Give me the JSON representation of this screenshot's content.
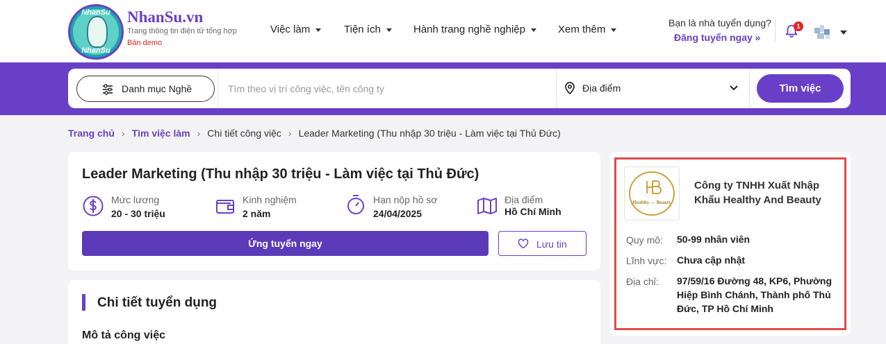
{
  "header": {
    "logo_top": "NhanSu",
    "logo_bottom": "NhanSu",
    "brand_name": "NhanSu.vn",
    "brand_tagline": "Trang thông tin điện tử tổng hợp",
    "brand_demo": "Bản demo",
    "nav": [
      {
        "label": "Việc làm"
      },
      {
        "label": "Tiện ích"
      },
      {
        "label": "Hành trang nghề nghiệp"
      },
      {
        "label": "Xem thêm"
      }
    ],
    "recruiter_question": "Bạn là nhà tuyển dụng?",
    "recruiter_link": "Đăng tuyển ngay »",
    "notification_count": "1"
  },
  "search": {
    "category_label": "Danh mục Nghề",
    "keyword_placeholder": "Tìm theo vị trí công việc, tên công ty",
    "location_label": "Địa điểm",
    "submit_label": "Tìm việc"
  },
  "breadcrumb": [
    {
      "label": "Trang chủ"
    },
    {
      "label": "Tìm việc làm"
    },
    {
      "label": "Chi tiết công việc"
    },
    {
      "label": "Leader Marketing (Thu nhập 30 triệu - Làm việc tại Thủ Đức)"
    }
  ],
  "job": {
    "title": "Leader Marketing (Thu nhập 30 triệu - Làm việc tại Thủ Đức)",
    "info": [
      {
        "label": "Mức lương",
        "value": "20 - 30 triệu"
      },
      {
        "label": "Kinh nghiệm",
        "value": "2 năm"
      },
      {
        "label": "Hạn nộp hồ sơ",
        "value": "24/04/2025"
      },
      {
        "label": "Địa điểm",
        "value": "Hồ Chí Minh"
      }
    ],
    "apply_label": "Ứng tuyển ngay",
    "save_label": "Lưu tin"
  },
  "detail": {
    "section_title": "Chi tiết tuyển dụng",
    "description_title": "Mô tả công việc"
  },
  "company": {
    "logo_text": "Healthy — Beauty",
    "name": "Công ty TNHH Xuất Nhập Khẩu Healthy And Beauty",
    "size_label": "Quy mô:",
    "size_value": "50-99 nhân viên",
    "field_label": "Lĩnh vực:",
    "field_value": "Chưa cập nhật",
    "address_label": "Địa chỉ:",
    "address_value": "97/59/16 Đường 48, KP6, Phường Hiệp Bình Chánh, Thành phố Thủ Đức, TP Hồ Chí Minh"
  },
  "colors": {
    "brand": "#6a3fc8",
    "apply": "#5b3ab8",
    "highlight": "#e04a4a",
    "badge": "#e02424"
  }
}
